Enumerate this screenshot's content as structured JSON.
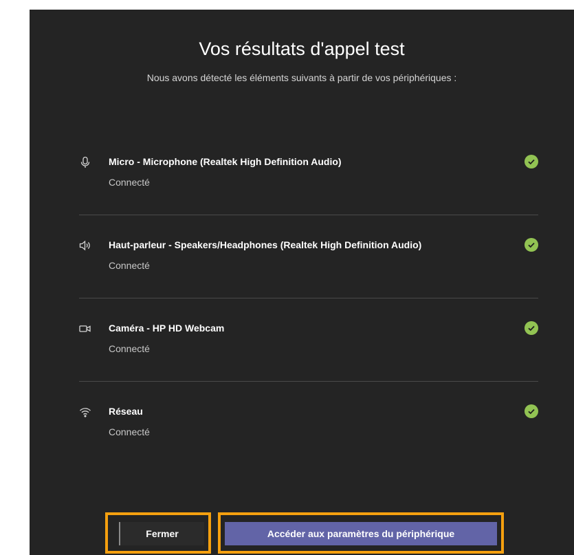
{
  "dialog": {
    "title": "Vos résultats d'appel test",
    "subtitle": "Nous avons détecté les éléments suivants à partir de vos périphériques :"
  },
  "devices": [
    {
      "icon": "microphone-icon",
      "name": "Micro - Microphone (Realtek High Definition Audio)",
      "status": "Connecté"
    },
    {
      "icon": "speaker-icon",
      "name": "Haut-parleur - Speakers/Headphones (Realtek High Definition Audio)",
      "status": "Connecté"
    },
    {
      "icon": "camera-icon",
      "name": "Caméra - HP HD Webcam",
      "status": "Connecté"
    },
    {
      "icon": "wifi-icon",
      "name": "Réseau",
      "status": "Connecté"
    }
  ],
  "buttons": {
    "close_label": "Fermer",
    "settings_label": "Accéder aux paramètres du périphérique"
  },
  "colors": {
    "background": "#242424",
    "check": "#92c353",
    "primary": "#6264a7",
    "highlight": "#f5a00f"
  }
}
